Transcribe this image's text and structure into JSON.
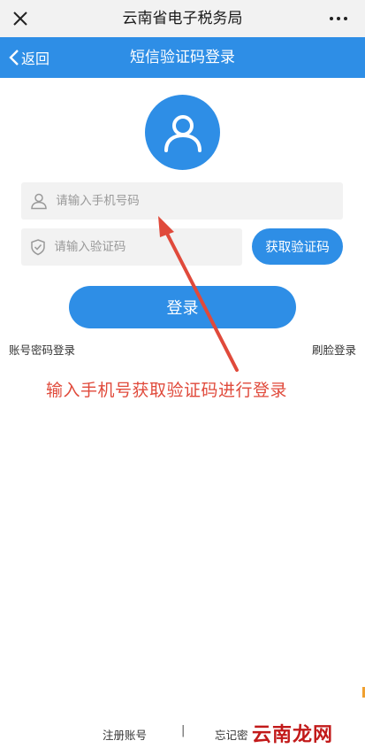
{
  "wechat_bar": {
    "title": "云南省电子税务局"
  },
  "nav": {
    "back_label": "返回",
    "title": "短信验证码登录"
  },
  "form": {
    "phone_placeholder": "请输入手机号码",
    "phone_value": "",
    "code_placeholder": "请输入验证码",
    "code_value": "",
    "get_code_label": "获取验证码",
    "login_label": "登录"
  },
  "links": {
    "password_login": "账号密码登录",
    "face_login": "刷脸登录"
  },
  "annotation": {
    "text": "输入手机号获取验证码进行登录"
  },
  "footer": {
    "register": "注册账号",
    "separator": "|",
    "forgot": "忘记密"
  },
  "watermark": {
    "text": "云南龙网"
  },
  "colors": {
    "primary": "#2e8ee6",
    "annotation": "#e04a3b",
    "input_bg": "#f2f2f2"
  },
  "icons": [
    "close-icon",
    "more-icon",
    "back-chevron-icon",
    "user-avatar-icon",
    "person-icon",
    "shield-icon"
  ]
}
